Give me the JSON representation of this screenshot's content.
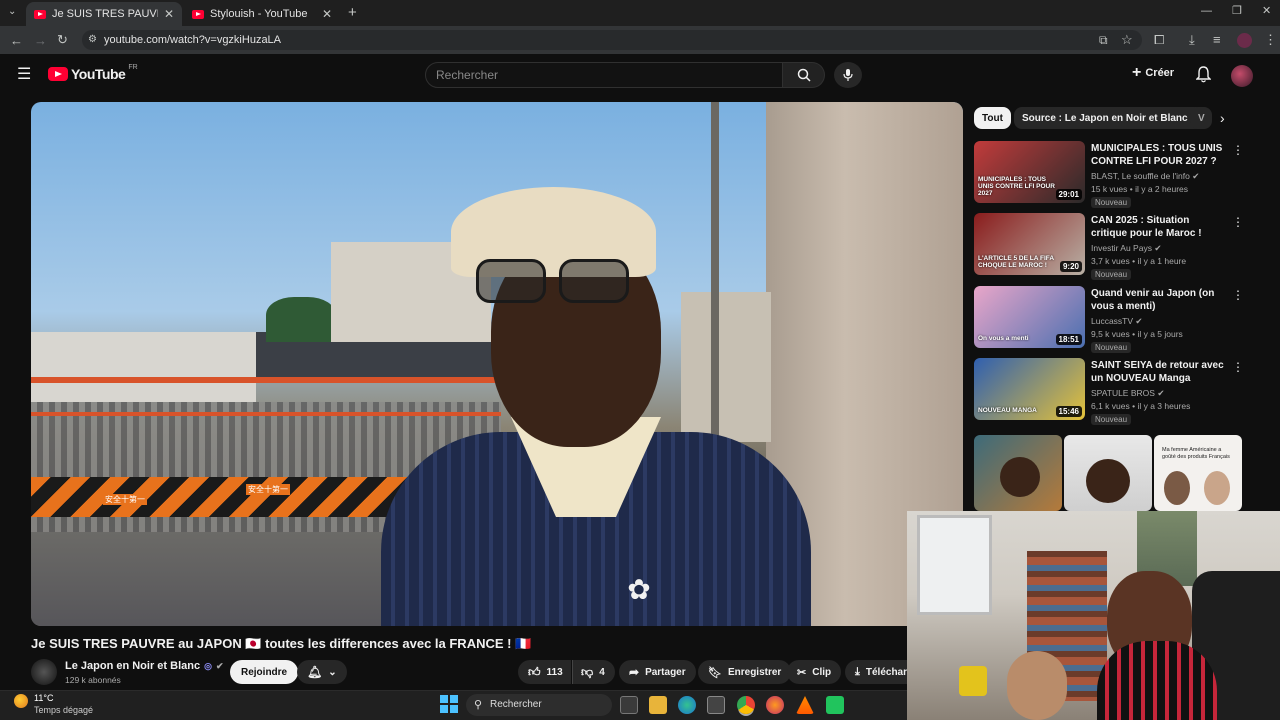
{
  "browser": {
    "tabs": [
      {
        "label": "Je SUIS TRES PAUVRE au JAPON"
      },
      {
        "label": "Stylouish - YouTube"
      }
    ],
    "new_tab": "+",
    "url": "youtube.com/watch?v=vgzkiHuzaLA"
  },
  "youtube": {
    "logo": "YouTube",
    "region": "FR",
    "search_placeholder": "Rechercher",
    "create_label": "Créer"
  },
  "video": {
    "title": "Je SUIS TRES PAUVRE au JAPON 🇯🇵 toutes les differences avec la FRANCE ! 🇫🇷",
    "channel": "Le Japon en Noir et Blanc",
    "subscribers": "129 k abonnés",
    "join_label": "Rejoindre",
    "likes": "113",
    "dislikes": "4",
    "share_label": "Partager",
    "save_label": "Enregistrer",
    "clip_label": "Clip",
    "download_label": "Téléchar",
    "sign_text_1": "安全十第一",
    "sign_text_2": "安全十第一"
  },
  "sidebar": {
    "chips": [
      "Tout",
      "Source : Le Japon en Noir et Blanc",
      "V"
    ],
    "recommendations": [
      {
        "title": "MUNICIPALES : TOUS UNIS CONTRE LFI POUR 2027 ?",
        "channel": "BLAST, Le souffle de l'info",
        "meta": "15 k vues • il y a 2 heures",
        "badge": "Nouveau",
        "duration": "29:01",
        "thumb_text": "MUNICIPALES : TOUS UNIS CONTRE LFI POUR 2027",
        "colors": [
          "#c23b3b",
          "#2a2a2a"
        ]
      },
      {
        "title": "CAN 2025 : Situation critique pour le Maroc !",
        "channel": "Investir Au Pays",
        "meta": "3,7 k vues • il y a 1 heure",
        "badge": "Nouveau",
        "duration": "9:20",
        "thumb_text": "L'ARTICLE 5 DE LA FIFA CHOQUE LE MAROC !",
        "colors": [
          "#8a1c1c",
          "#b8b0a5"
        ]
      },
      {
        "title": "Quand venir au Japon (on vous a menti)",
        "channel": "LuccassTV",
        "meta": "9,5 k vues • il y a 5 jours",
        "badge": "Nouveau",
        "duration": "18:51",
        "thumb_text": "On vous a menti",
        "colors": [
          "#e9a6c9",
          "#4a6fb0"
        ]
      },
      {
        "title": "SAINT SEIYA de retour avec un NOUVEAU Manga",
        "channel": "SPATULE BROS",
        "meta": "6,1 k vues • il y a 3 heures",
        "badge": "Nouveau",
        "duration": "15:46",
        "thumb_text": "NOUVEAU MANGA",
        "colors": [
          "#2f5fb0",
          "#e4c23a"
        ]
      }
    ],
    "shorts": [
      {
        "caption": ""
      },
      {
        "caption": ""
      },
      {
        "caption": "Ma femme Américaine a goûté des produits Français"
      }
    ]
  },
  "taskbar": {
    "temperature": "11°C",
    "weather": "Temps dégagé",
    "search": "Rechercher"
  }
}
